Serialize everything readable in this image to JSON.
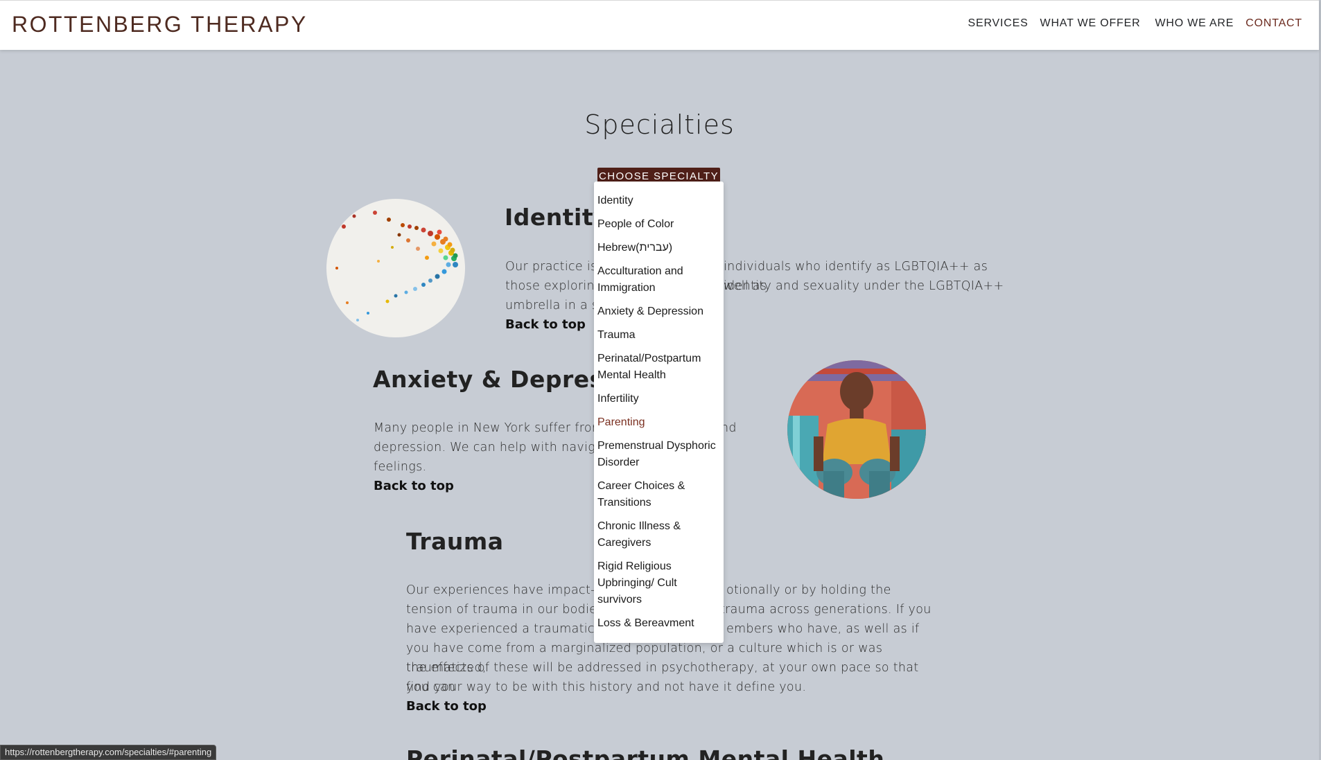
{
  "header": {
    "brand": "ROTTENBERG THERAPY",
    "nav": [
      "SERVICES",
      "WHAT WE OFFER",
      "WHO WE ARE",
      "CONTACT"
    ]
  },
  "page_title": "Specialties",
  "choose_button": "CHOOSE SPECIALTY",
  "dropdown": {
    "options": [
      "Identity",
      "People of Color",
      "Hebrew(עברית)",
      "Acculturation and Immigration",
      "Anxiety & Depression",
      "Trauma",
      "Perinatal/Postpartum Mental Health",
      "Infertility",
      "Parenting",
      "Premenstrual Dysphoric Disorder",
      "Career Choices & Transitions",
      "Chronic Illness & Caregivers",
      "Rigid Religious Upbringing/ Cult survivors",
      "Loss & Bereavment"
    ],
    "hovered": "Parenting"
  },
  "sections": {
    "identity": {
      "title": "Identity",
      "body": "Our practice is c                                                          individuals who identify as LGBTQIA++ as well as those exploring                                                          identity and sexuality under the LGBTQIA++ umbrella in a sa",
      "body_lines": [
        "Our practice is c",
        "individuals who identify as LGBTQIA++ as well as",
        "those exploring",
        "identity and sexuality under the LGBTQIA++",
        "umbrella in a sa"
      ],
      "back": "Back to top"
    },
    "anxiety": {
      "title": "Anxiety & Depressior",
      "body_lines": [
        "Many people in New York suffer from a",
        "nd",
        "depression. We can help with navigating",
        "feelings."
      ],
      "back": "Back to top"
    },
    "trauma": {
      "title": "Trauma",
      "body_lines": [
        "Our experiences have impact- we",
        "otionally or by holding the",
        "tension of trauma in our bodies. W",
        "trauma across generations. If you",
        "have experienced a traumatic eve",
        "embers who have, as well as if",
        "you have come from a marginalized population, or a culture which is or was traumatized,",
        "the effects of these will be addressed in psychotherapy, at your own pace so that you can",
        "find your way to be with this history and not have it define you."
      ],
      "back": "Back to top"
    },
    "perinatal": {
      "title": "Perinatal/Postpartum Mental Health"
    }
  },
  "status_bar": "https://rottenbergtherapy.com/specialties/#parenting",
  "colors": {
    "background": "#c7ccd4",
    "brand": "#4e2a20",
    "button": "#4f1f18",
    "hover": "#7a2f20"
  }
}
